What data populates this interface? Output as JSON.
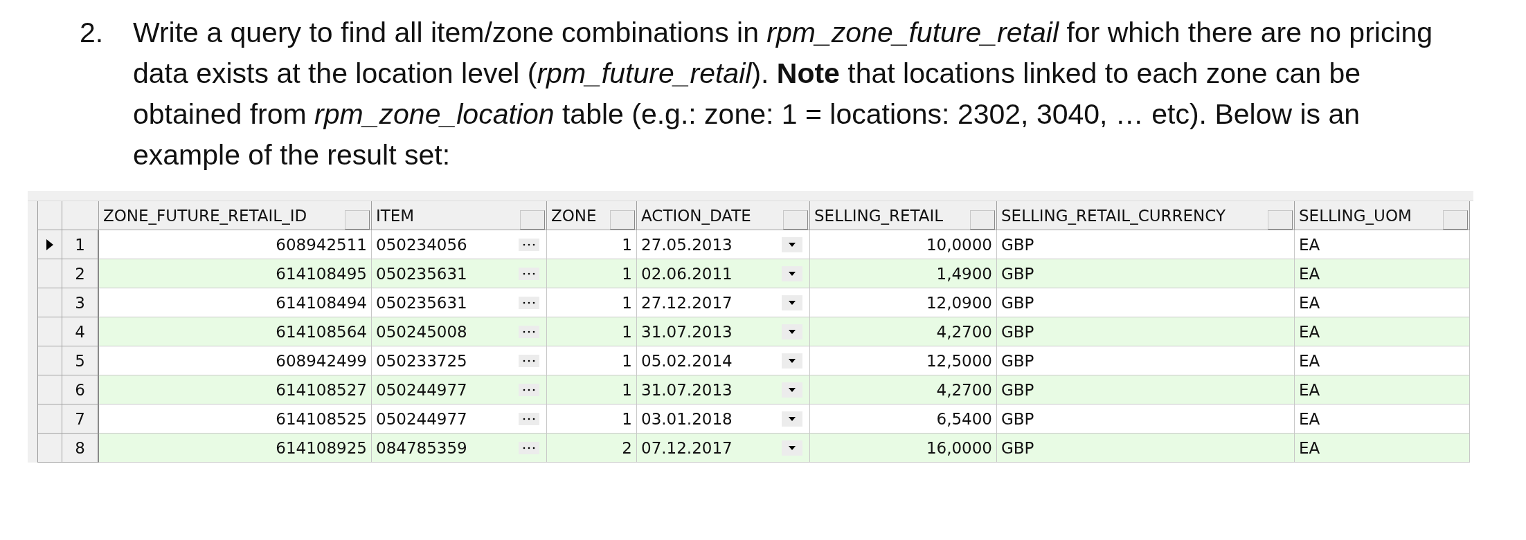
{
  "question": {
    "number": "2.",
    "text": "Write a query to find all item/zone combinations in *rpm_zone_future_retail* for which there are no pricing data exists at the location level (*rpm_future_retail*). **Note** that locations linked to each zone can be obtained from *rpm_zone_location* table (e.g.: zone: 1 = locations: 2302, 3040, … etc). Below is an example of the result set:"
  },
  "grid": {
    "columns": [
      {
        "label": "ZONE_FUTURE_RETAIL_ID",
        "kind": "number"
      },
      {
        "label": "ITEM",
        "kind": "lookup"
      },
      {
        "label": "ZONE",
        "kind": "number"
      },
      {
        "label": "ACTION_DATE",
        "kind": "date"
      },
      {
        "label": "SELLING_RETAIL",
        "kind": "number"
      },
      {
        "label": "SELLING_RETAIL_CURRENCY",
        "kind": "text"
      },
      {
        "label": "SELLING_UOM",
        "kind": "text"
      }
    ],
    "rows": [
      {
        "number": "1",
        "selected": true,
        "cells": [
          "608942511",
          "050234056",
          "1",
          "27.05.2013",
          "10,0000",
          "GBP",
          "EA"
        ]
      },
      {
        "number": "2",
        "selected": false,
        "cells": [
          "614108495",
          "050235631",
          "1",
          "02.06.2011",
          "1,4900",
          "GBP",
          "EA"
        ]
      },
      {
        "number": "3",
        "selected": false,
        "cells": [
          "614108494",
          "050235631",
          "1",
          "27.12.2017",
          "12,0900",
          "GBP",
          "EA"
        ]
      },
      {
        "number": "4",
        "selected": false,
        "cells": [
          "614108564",
          "050245008",
          "1",
          "31.07.2013",
          "4,2700",
          "GBP",
          "EA"
        ]
      },
      {
        "number": "5",
        "selected": false,
        "cells": [
          "608942499",
          "050233725",
          "1",
          "05.02.2014",
          "12,5000",
          "GBP",
          "EA"
        ]
      },
      {
        "number": "6",
        "selected": false,
        "cells": [
          "614108527",
          "050244977",
          "1",
          "31.07.2013",
          "4,2700",
          "GBP",
          "EA"
        ]
      },
      {
        "number": "7",
        "selected": false,
        "cells": [
          "614108525",
          "050244977",
          "1",
          "03.01.2018",
          "6,5400",
          "GBP",
          "EA"
        ]
      },
      {
        "number": "8",
        "selected": false,
        "cells": [
          "614108925",
          "084785359",
          "2",
          "07.12.2017",
          "16,0000",
          "GBP",
          "EA"
        ]
      }
    ]
  }
}
